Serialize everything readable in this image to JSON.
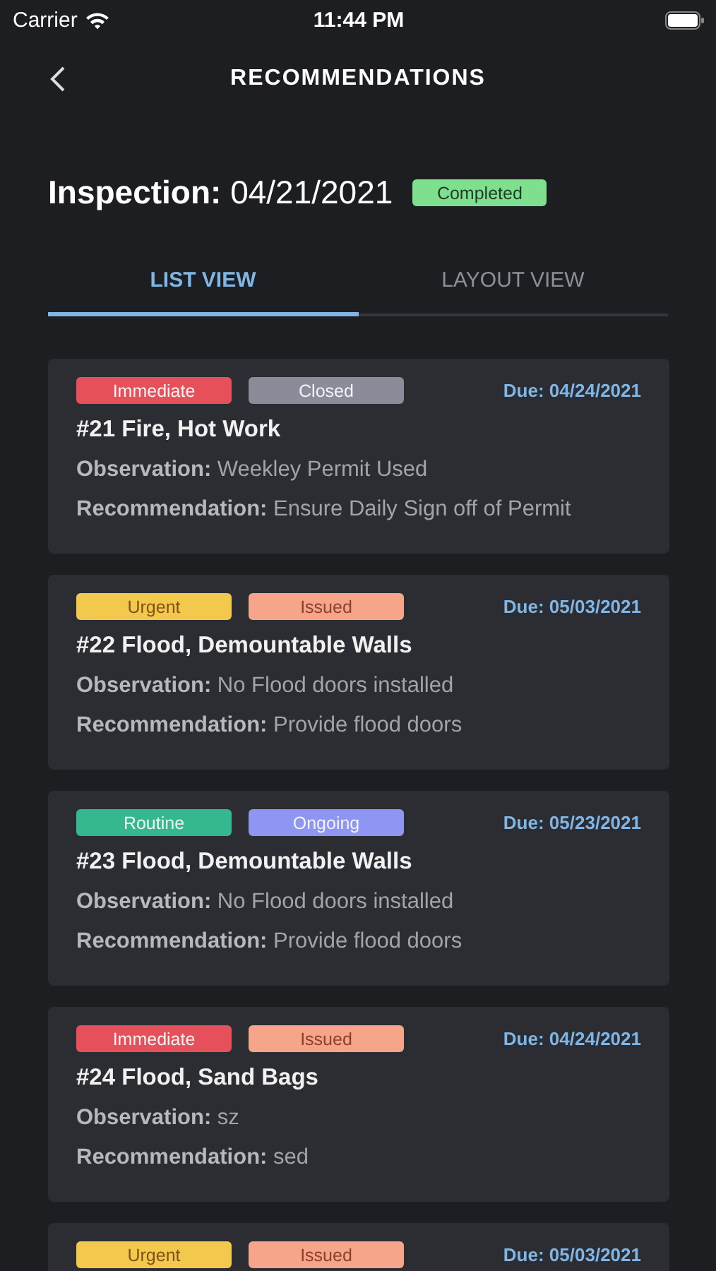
{
  "status_bar": {
    "carrier": "Carrier",
    "time": "11:44 PM"
  },
  "nav": {
    "title": "RECOMMENDATIONS"
  },
  "inspection": {
    "label": "Inspection:",
    "date": "04/21/2021",
    "status": {
      "label": "Completed",
      "color": "#7ee08f"
    }
  },
  "tabs": [
    {
      "label": "LIST VIEW",
      "selected": true
    },
    {
      "label": "LAYOUT VIEW",
      "selected": false
    }
  ],
  "recommendations": [
    {
      "priority": {
        "label": "Immediate",
        "color": "#e5505a"
      },
      "status": {
        "label": "Closed",
        "color": "#8a8d99"
      },
      "due": "Due: 04/24/2021",
      "title": "#21 Fire, Hot Work",
      "observation_label": "Observation:",
      "observation": "Weekley Permit Used",
      "recommendation_label": "Recommendation:",
      "recommendation": "Ensure Daily Sign off of Permit"
    },
    {
      "priority": {
        "label": "Urgent",
        "color": "#f2c94c"
      },
      "status": {
        "label": "Issued",
        "color": "#f7a58a"
      },
      "due": "Due: 05/03/2021",
      "title": "#22 Flood, Demountable Walls",
      "observation_label": "Observation:",
      "observation": "No Flood doors installed",
      "recommendation_label": "Recommendation:",
      "recommendation": "Provide flood doors"
    },
    {
      "priority": {
        "label": "Routine",
        "color": "#35b88f"
      },
      "status": {
        "label": "Ongoing",
        "color": "#8f95f2"
      },
      "due": "Due: 05/23/2021",
      "title": "#23 Flood, Demountable Walls",
      "observation_label": "Observation:",
      "observation": "No Flood doors installed",
      "recommendation_label": "Recommendation:",
      "recommendation": "Provide flood doors"
    },
    {
      "priority": {
        "label": "Immediate",
        "color": "#e5505a"
      },
      "status": {
        "label": "Issued",
        "color": "#f7a58a"
      },
      "due": "Due: 04/24/2021",
      "title": "#24 Flood, Sand Bags",
      "observation_label": "Observation:",
      "observation": "sz",
      "recommendation_label": "Recommendation:",
      "recommendation": "sed"
    },
    {
      "priority": {
        "label": "Urgent",
        "color": "#f2c94c"
      },
      "status": {
        "label": "Issued",
        "color": "#f7a58a"
      },
      "due": "Due: 05/03/2021"
    }
  ]
}
